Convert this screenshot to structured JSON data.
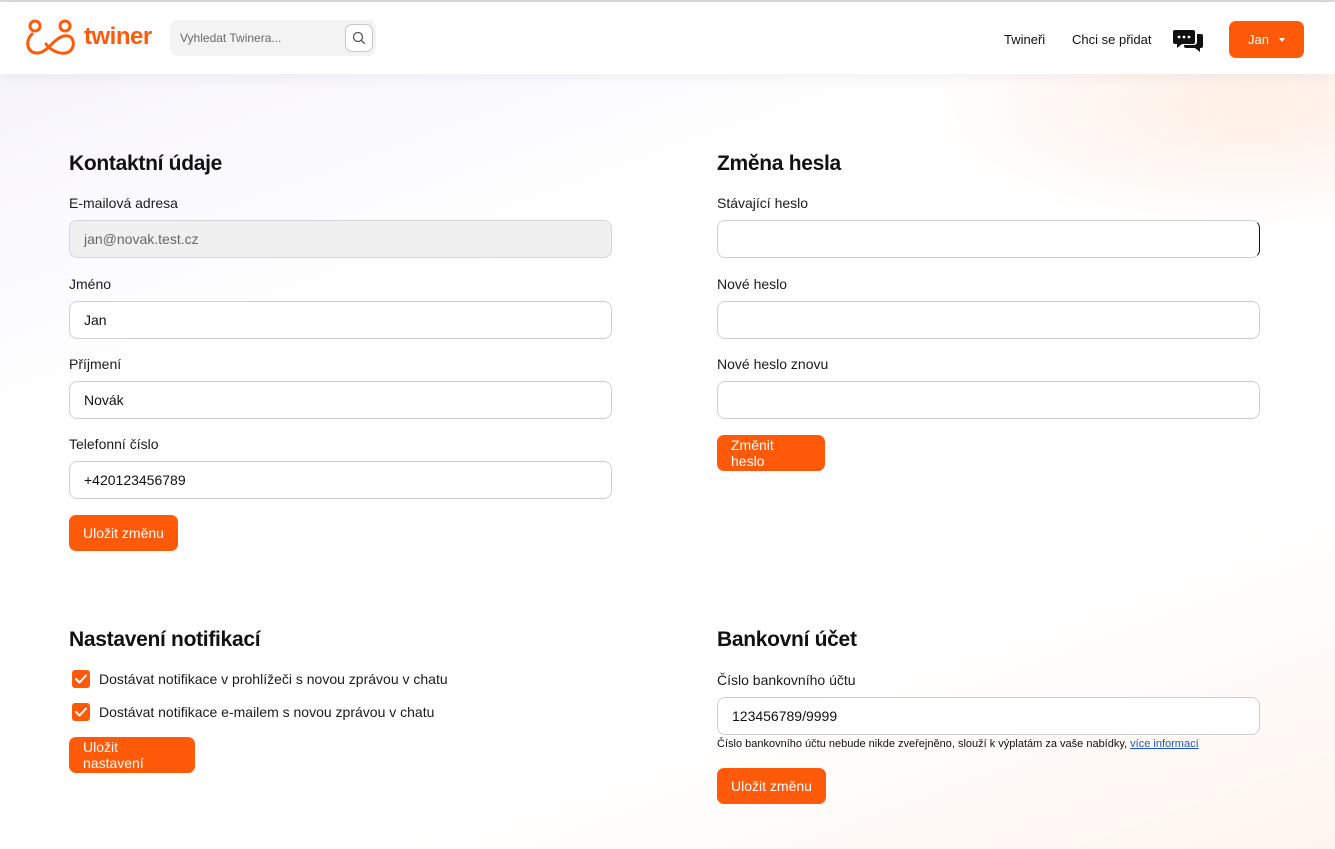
{
  "brand": {
    "name": "twiner",
    "color": "#ff5a0a"
  },
  "header": {
    "search_placeholder": "Vyhledat Twinera...",
    "nav": [
      "Twineři",
      "Chci se přidat"
    ],
    "user_label": "Jan"
  },
  "contact": {
    "title": "Kontaktní údaje",
    "email_label": "E-mailová adresa",
    "email_value": "jan@novak.test.cz",
    "first_name_label": "Jméno",
    "first_name_value": "Jan",
    "last_name_label": "Příjmení",
    "last_name_value": "Novák",
    "phone_label": "Telefonní číslo",
    "phone_value": "+420123456789",
    "save_label": "Uložit změnu"
  },
  "password": {
    "title": "Změna hesla",
    "current_label": "Stávající heslo",
    "new_label": "Nové heslo",
    "repeat_label": "Nové heslo znovu",
    "submit_label": "Změnit heslo"
  },
  "notifications": {
    "title": "Nastavení notifikací",
    "options": [
      {
        "label": "Dostávat notifikace v prohlížeči s novou zprávou v chatu",
        "checked": true
      },
      {
        "label": "Dostávat notifikace e-mailem s novou zprávou v chatu",
        "checked": true
      }
    ],
    "save_label": "Uložit nastavení"
  },
  "bank": {
    "title": "Bankovní účet",
    "account_label": "Číslo bankovního účtu",
    "account_value": "123456789/9999",
    "hint_text": "Číslo bankovního účtu nebude nikde zveřejněno, slouží k výplatám za vaše nabídky, ",
    "hint_link": "více informací",
    "save_label": "Uložit změnu"
  }
}
